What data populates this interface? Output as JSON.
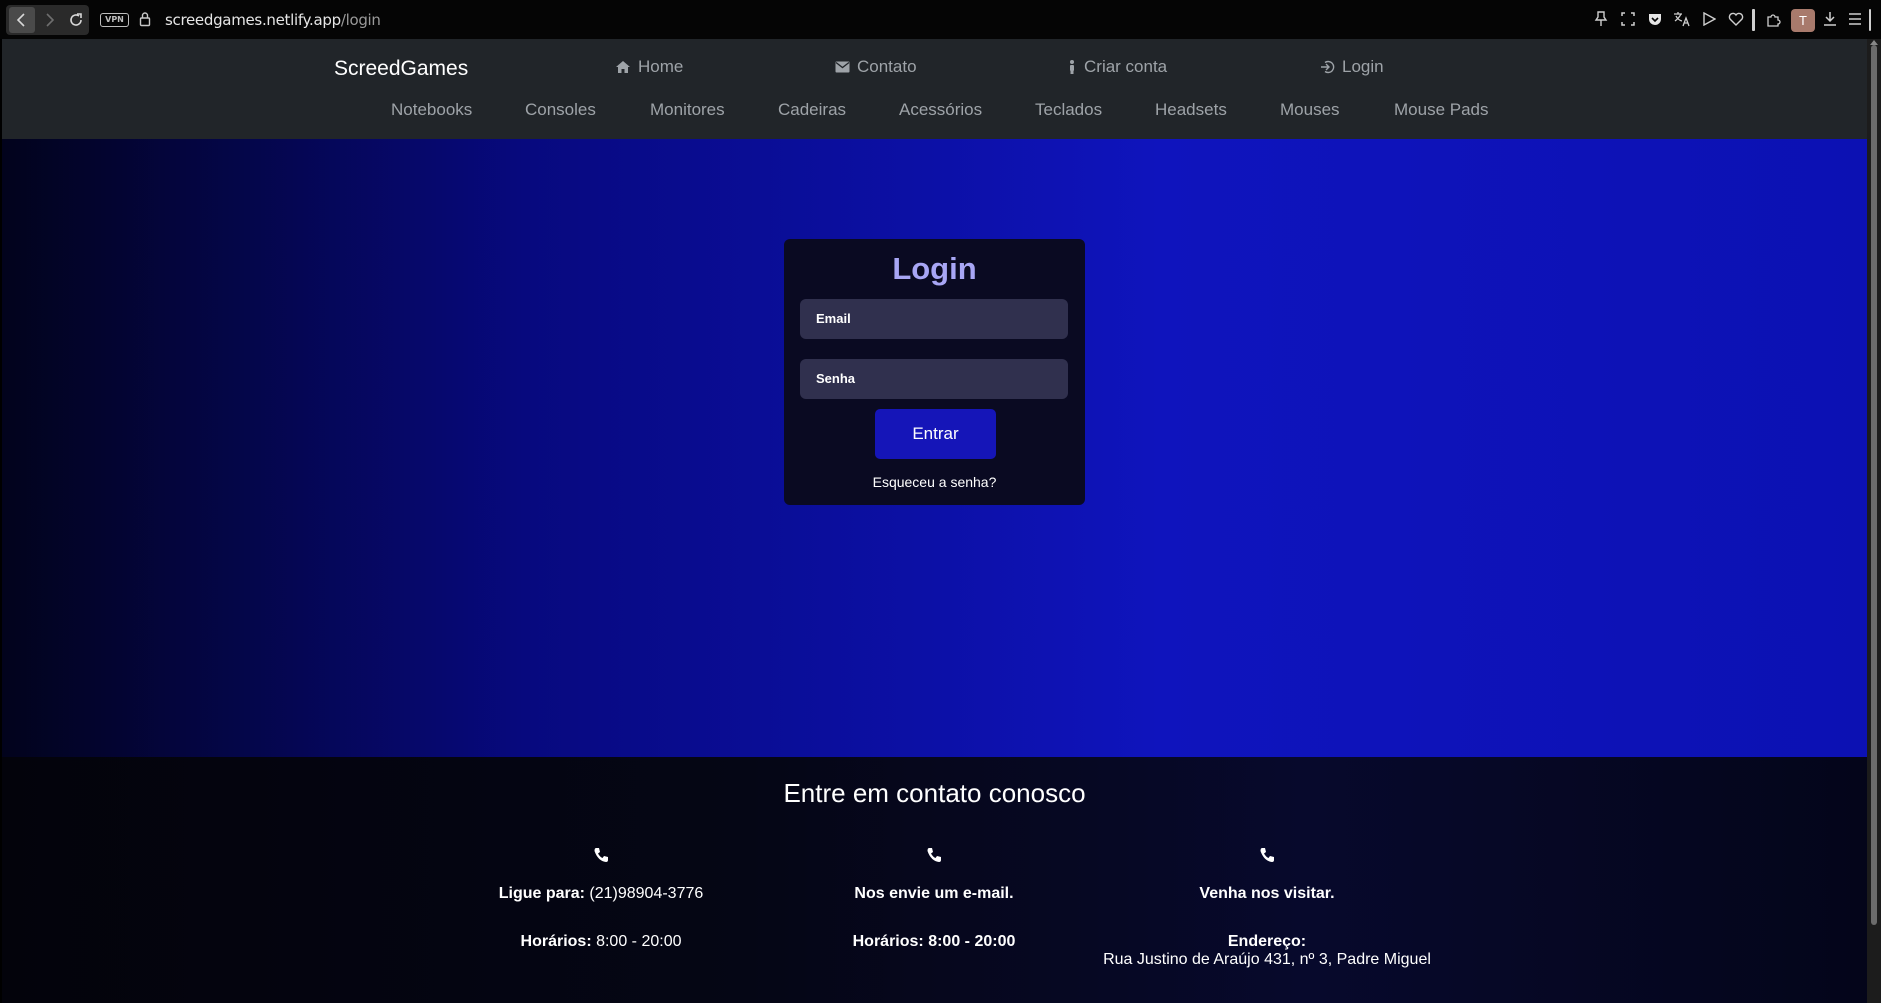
{
  "browser": {
    "vpn_label": "VPN",
    "url_domain": "screedgames.netlify.app",
    "url_path": "/login",
    "avatar_letter": "T"
  },
  "navbar": {
    "brand": "ScreedGames",
    "top_links": [
      {
        "label": "Home",
        "icon": "home-icon"
      },
      {
        "label": "Contato",
        "icon": "mail-icon"
      },
      {
        "label": "Criar conta",
        "icon": "person-icon"
      },
      {
        "label": "Login",
        "icon": "login-icon"
      }
    ],
    "categories": [
      "Notebooks",
      "Consoles",
      "Monitores",
      "Cadeiras",
      "Acessórios",
      "Teclados",
      "Headsets",
      "Mouses",
      "Mouse Pads"
    ]
  },
  "login": {
    "title": "Login",
    "email_placeholder": "Email",
    "password_placeholder": "Senha",
    "submit_label": "Entrar",
    "forgot_label": "Esqueceu a senha?"
  },
  "footer": {
    "title": "Entre em contato conosco",
    "columns": [
      {
        "icon": "phone-icon",
        "line1_bold": "Ligue para:",
        "line1_text": " (21)98904-3776",
        "line2_bold": "Horários:",
        "line2_text": " 8:00 - 20:00"
      },
      {
        "icon": "phone-icon",
        "line1_bold": "Nos envie um e-mail.",
        "line1_text": "",
        "line2_bold": "Horários: 8:00 - 20:00",
        "line2_text": ""
      },
      {
        "icon": "phone-icon",
        "line1_bold": "Venha nos visitar.",
        "line1_text": "",
        "line2_bold": "Endereço:",
        "line2_text": "Rua Justino de Araújo 431, nº 3, Padre Miguel"
      }
    ]
  },
  "colors": {
    "navbar_bg": "#212529",
    "hero_accent": "#0f14bd",
    "login_title": "#a8a6f5",
    "button_bg": "#1515b8"
  }
}
